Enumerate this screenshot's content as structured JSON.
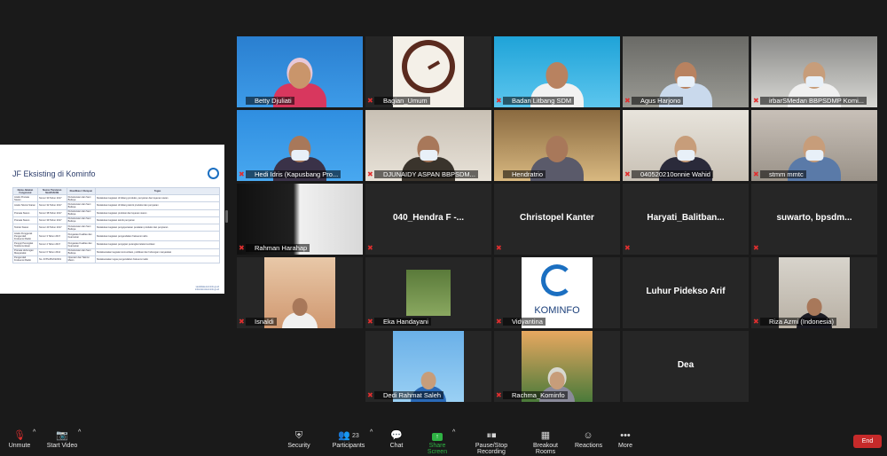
{
  "shared_screen": {
    "title": "JF Eksisting di Kominfo",
    "columns": [
      "Nama Jabatan Fungsional",
      "Nomor Peraturan MenPAN RB",
      "Klasifikasi / Rumpun",
      "Tugas"
    ],
    "rows": [
      [
        "Analis Pranata Siaran",
        "Nomor 30 Tahun 2017",
        "Pertelevisian dan Seni Budaya",
        "Melakukan kegiatan di bidang produksi, penyiaran dan layanan siaran"
      ],
      [
        "Analis Teknisi Siaran",
        "Nomor 32 Tahun 2017",
        "Pertelevisian dan Seni Budaya",
        "Melakukan kegiatan di bidang teknik produksi dan penyiaran"
      ],
      [
        "Pranata Siaran",
        "Nomor 38 Tahun 2017",
        "Pertelevisian dan Seni Budaya",
        "Melakukan kegiatan produksi dan layanan siaran"
      ],
      [
        "Pranata Siaran",
        "Nomor 39 Tahun 2017",
        "Pertelevisian dan Seni Budaya",
        "Melakukan kegiatan teknik penyiaran"
      ],
      [
        "Teknisi Siaran",
        "Nomor 40 Tahun 2017",
        "Pertelevisian dan Seni Budaya",
        "Melakukan kegiatan pengoperasian peralatan produksi dan penyiaran"
      ],
      [
        "Analis Penggerak Pengendali Frekuensi Radio",
        "Nomor 3 Tahun 2017",
        "Pengawas Kualitas dan Keamanan",
        "Melakukan kegiatan pengendalian frekuensi radio"
      ],
      [
        "Penguji Perangkat Telekomunikasi",
        "Nomor 4 Tahun 2017",
        "Pengawas Kualitas dan Keamanan",
        "Melakukan kegiatan pengujian perangkat telekomunikasi"
      ],
      [
        "Pranata Hubungan Masyarakat",
        "Nomor 6 Tahun 2014",
        "Pertelevisian dan Seni Budaya",
        "Melaksanakan kegiatan komunikasi, publikasi dan hubungan masyarakat"
      ],
      [
        "Pengendali Frekuensi Radio",
        "No. 07/PL/B/VIII/2001",
        "Operator dan Teknisi Mesin",
        "Melaksanakan tugas pengendalian frekuensi radio"
      ]
    ],
    "footer_lines": [
      "sandidata.kominfo.go.id",
      "infosinkronkominfo.go.id"
    ]
  },
  "participants": [
    {
      "name": "Betty Djuliati",
      "muted": false,
      "video": true
    },
    {
      "name": "Bagian_Umum",
      "muted": true,
      "video": true
    },
    {
      "name": "Badan Litbang SDM",
      "muted": true,
      "video": true
    },
    {
      "name": "Agus Harjono",
      "muted": true,
      "video": true
    },
    {
      "name": "irbarSMedan BBPSDMP Komi...",
      "muted": true,
      "video": true
    },
    {
      "name": "Hedi Idris (Kapusbang Pro...",
      "muted": true,
      "video": true
    },
    {
      "name": "DJUNAIDY ASPAN BBPSDM...",
      "muted": true,
      "video": true
    },
    {
      "name": "Hendratrio",
      "muted": false,
      "video": true,
      "active": true
    },
    {
      "name": "040520210onnie Wahid",
      "muted": true,
      "video": true
    },
    {
      "name": "stmm mmtc",
      "muted": true,
      "video": true
    },
    {
      "name": "Rahman Harahap",
      "muted": true,
      "video": true
    },
    {
      "name": "040_Hendra F -...",
      "muted": true,
      "video": false
    },
    {
      "name": "Christopel Kanter",
      "muted": true,
      "video": false
    },
    {
      "name": "Haryati_Balitban...",
      "muted": true,
      "video": false
    },
    {
      "name": "suwarto, bpsdm...",
      "muted": true,
      "video": false
    },
    {
      "name": "Isnaldi",
      "muted": true,
      "video": true
    },
    {
      "name": "Eka Handayani",
      "muted": true,
      "video": true
    },
    {
      "name": "Vidyantina",
      "muted": true,
      "video": true
    },
    {
      "name": "Luhur Pidekso Arif",
      "muted": false,
      "video": false
    },
    {
      "name": "Riza Azmi (Indonesia)",
      "muted": true,
      "video": true
    },
    {
      "name": "Dedi Rahmat Saleh",
      "muted": true,
      "video": true
    },
    {
      "name": "Rachma_Kominfo",
      "muted": true,
      "video": true
    },
    {
      "name": "Dea",
      "muted": false,
      "video": false
    }
  ],
  "kominfo_logo_text": "KOMINFO",
  "toolbar": {
    "unmute": "Unmute",
    "start_video": "Start Video",
    "security": "Security",
    "participants": "Participants",
    "participants_count": "23",
    "chat": "Chat",
    "share_screen": "Share Screen",
    "record": "Pause/Stop Recording",
    "breakout": "Breakout Rooms",
    "reactions": "Reactions",
    "more": "More",
    "end": "End"
  },
  "colors": {
    "active_speaker": "#f7d200",
    "share_green": "#2fb344",
    "end_red": "#c62a2a",
    "muted_red": "#e02f2f"
  }
}
